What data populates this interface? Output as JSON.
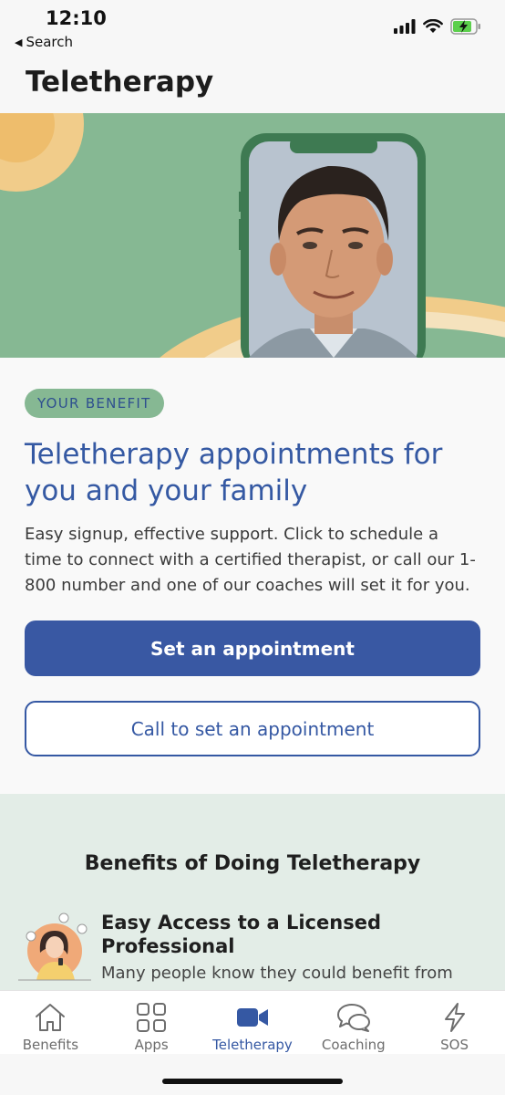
{
  "status_bar": {
    "time": "12:10",
    "back_label": "Search"
  },
  "page": {
    "title": "Teletherapy"
  },
  "card": {
    "badge": "YOUR BENEFIT",
    "headline": "Teletherapy appointments for you and your family",
    "description": "Easy signup, effective support. Click to schedule a time to connect with a certified therapist, or call our 1-800 number and one of our coaches will set it for you.",
    "primary_button": "Set an appointment",
    "secondary_button": "Call to set an appointment"
  },
  "benefits": {
    "title": "Benefits of Doing Teletherapy",
    "items": [
      {
        "heading": "Easy Access to a Licensed Professional",
        "text": "Many people know they could benefit from",
        "icon": "woman-with-phone-illustration"
      }
    ]
  },
  "tabbar": {
    "items": [
      {
        "label": "Benefits",
        "icon": "home-icon",
        "active": false
      },
      {
        "label": "Apps",
        "icon": "apps-grid-icon",
        "active": false
      },
      {
        "label": "Teletherapy",
        "icon": "video-camera-icon",
        "active": true
      },
      {
        "label": "Coaching",
        "icon": "chat-bubbles-icon",
        "active": false
      },
      {
        "label": "SOS",
        "icon": "lightning-icon",
        "active": false
      }
    ]
  },
  "colors": {
    "accent": "#3558a3",
    "hero_green": "#86b893",
    "benefits_bg": "#e3ede7",
    "sun": "#f1cc8a"
  }
}
